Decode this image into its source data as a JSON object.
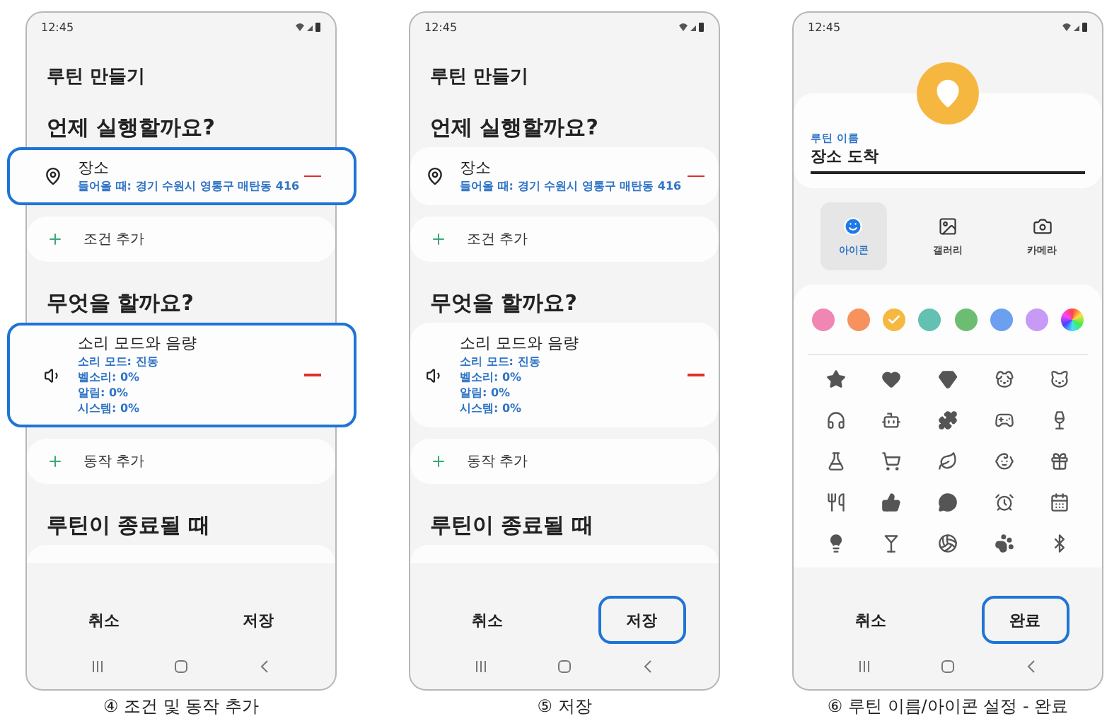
{
  "phones": [
    {
      "kind": "routine",
      "time": "12:45",
      "title": "루틴 만들기",
      "sections": [
        {
          "heading": "언제 실행할까요?",
          "items": [
            {
              "kind": "location",
              "title": "장소",
              "details": [
                "들어올 때:  경기 수원시 영통구 매탄동 416"
              ],
              "highlighted": true
            }
          ],
          "add": "조건 추가"
        },
        {
          "heading": "무엇을 할까요?",
          "items": [
            {
              "kind": "sound",
              "title": "소리 모드와 음량",
              "details": [
                "소리 모드: 진동",
                "벨소리: 0%",
                "알림: 0%",
                "시스템: 0%"
              ],
              "highlighted": true
            }
          ],
          "add": "동작 추가"
        },
        {
          "heading": "루틴이 종료될 때"
        }
      ],
      "buttons": [
        {
          "label": "취소",
          "highlighted": false
        },
        {
          "label": "저장",
          "highlighted": false
        }
      ],
      "caption": "④ 조건 및 동작 추가"
    },
    {
      "kind": "routine",
      "time": "12:45",
      "title": "루틴 만들기",
      "sections": [
        {
          "heading": "언제 실행할까요?",
          "items": [
            {
              "kind": "location",
              "title": "장소",
              "details": [
                "들어올 때:  경기 수원시 영통구 매탄동 416"
              ],
              "highlighted": false
            }
          ],
          "add": "조건 추가"
        },
        {
          "heading": "무엇을 할까요?",
          "items": [
            {
              "kind": "sound",
              "title": "소리 모드와 음량",
              "details": [
                "소리 모드: 진동",
                "벨소리: 0%",
                "알림: 0%",
                "시스템: 0%"
              ],
              "highlighted": false
            }
          ],
          "add": "동작 추가"
        },
        {
          "heading": "루틴이 종료될 때"
        }
      ],
      "buttons": [
        {
          "label": "취소",
          "highlighted": false
        },
        {
          "label": "저장",
          "highlighted": true
        }
      ],
      "caption": "⑤ 저장"
    },
    {
      "kind": "icon_setup",
      "time": "12:45",
      "name_label": "루틴 이름",
      "name_value": "장소 도착",
      "tabs": [
        {
          "label": "아이콘",
          "kind": "smile",
          "selected": true
        },
        {
          "label": "갤러리",
          "kind": "image",
          "selected": false
        },
        {
          "label": "카메라",
          "kind": "camera",
          "selected": false
        }
      ],
      "colors": [
        {
          "kind": "solid",
          "color": "#ef86b4",
          "selected": false
        },
        {
          "kind": "solid",
          "color": "#f7925e",
          "selected": false
        },
        {
          "kind": "solid",
          "color": "#f5b942",
          "selected": true
        },
        {
          "kind": "solid",
          "color": "#62c1b1",
          "selected": false
        },
        {
          "kind": "solid",
          "color": "#6cbc72",
          "selected": false
        },
        {
          "kind": "solid",
          "color": "#6c9ff0",
          "selected": false
        },
        {
          "kind": "solid",
          "color": "#c69af5",
          "selected": false
        },
        {
          "kind": "spectrum",
          "selected": false
        }
      ],
      "buttons": [
        {
          "label": "취소",
          "highlighted": false
        },
        {
          "label": "완료",
          "highlighted": true
        }
      ],
      "caption": "⑥ 루틴 이름/아이콘 설정 - 완료"
    }
  ]
}
